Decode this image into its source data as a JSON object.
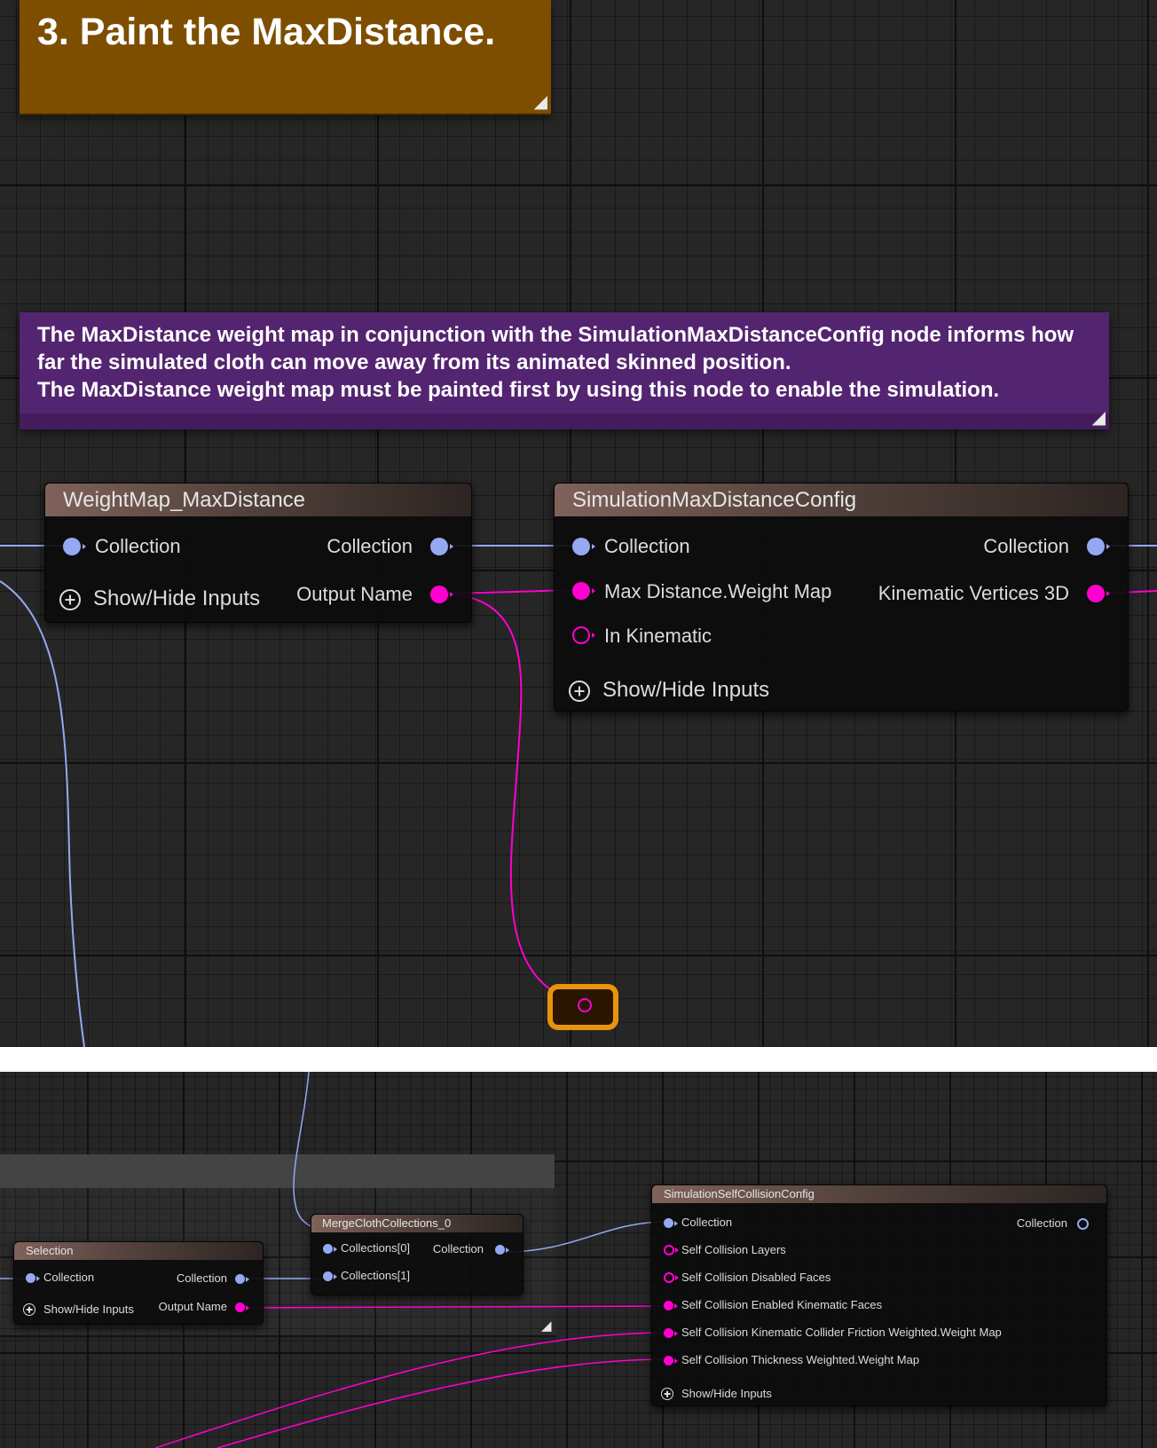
{
  "top": {
    "comment_step": {
      "text": "3. Paint the MaxDistance.",
      "color": "#7d4e00"
    },
    "comment_info": {
      "lines": [
        "The MaxDistance weight map in conjunction with the SimulationMaxDistanceConfig node informs how",
        "far the simulated cloth can move away from its animated skinned position.",
        "The MaxDistance weight map must be painted first by using this node to enable the simulation."
      ],
      "color": "#532470"
    },
    "node_weightmap": {
      "title": "WeightMap_MaxDistance",
      "in_collection": "Collection",
      "out_collection": "Collection",
      "show_hide": "Show/Hide Inputs",
      "out_name": "Output Name"
    },
    "node_maxdist": {
      "title": "SimulationMaxDistanceConfig",
      "in_collection": "Collection",
      "in_weightmap": "Max Distance.Weight Map",
      "in_kinematic": "In Kinematic",
      "show_hide": "Show/Hide Inputs",
      "out_collection": "Collection",
      "out_kinematic": "Kinematic Vertices 3D"
    }
  },
  "bottom": {
    "node_selection": {
      "title": "Selection",
      "in_collection": "Collection",
      "out_collection": "Collection",
      "show_hide": "Show/Hide Inputs",
      "out_name": "Output Name"
    },
    "node_merge": {
      "title": "MergeClothCollections_0",
      "in_0": "Collections[0]",
      "in_1": "Collections[1]",
      "out_collection": "Collection"
    },
    "node_selfcollision": {
      "title": "SimulationSelfCollisionConfig",
      "in_collection": "Collection",
      "in_layers": "Self Collision Layers",
      "in_disabled": "Self Collision Disabled Faces",
      "in_enabled": "Self Collision Enabled Kinematic Faces",
      "in_friction": "Self Collision Kinematic Collider Friction Weighted.Weight Map",
      "in_thickness": "Self Collision Thickness Weighted.Weight Map",
      "show_hide": "Show/Hide Inputs",
      "out_collection": "Collection"
    }
  },
  "colors": {
    "pin_collection": "#95a8f2",
    "pin_weightmap": "#ff00d0",
    "reroute": "#e8940b"
  }
}
